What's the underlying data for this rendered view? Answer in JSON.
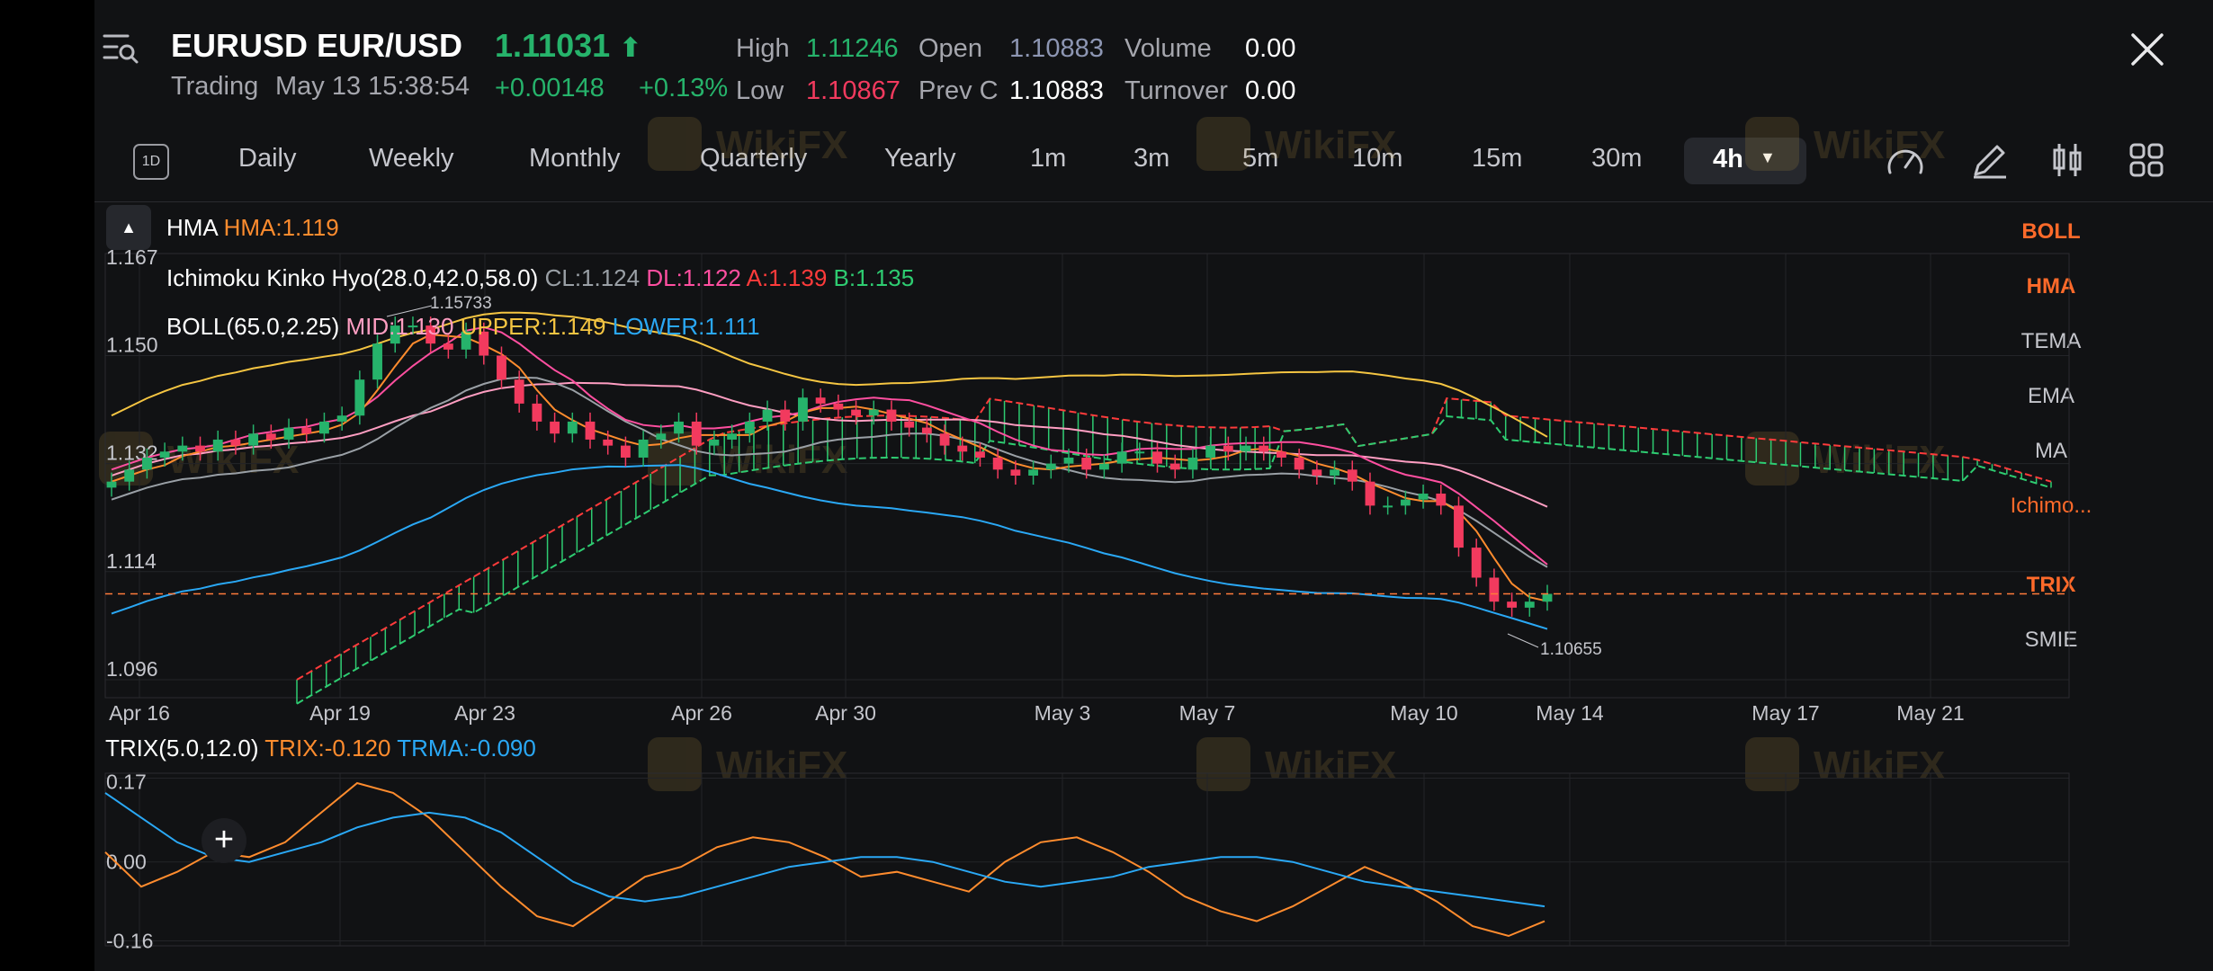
{
  "header": {
    "symbol": "EURUSD",
    "name": "EUR/USD",
    "price": "1.11031",
    "status": "Trading",
    "datetime": "May 13 15:38:54",
    "change": "+0.00148",
    "change_pct": "+0.13%",
    "high_label": "High",
    "high": "1.11246",
    "open_label": "Open",
    "open": "1.10883",
    "volume_label": "Volume",
    "volume": "0.00",
    "low_label": "Low",
    "low": "1.10867",
    "prevc_label": "Prev C",
    "prevc": "1.10883",
    "turnover_label": "Turnover",
    "turnover": "0.00"
  },
  "timeframes": {
    "period_icon_text": "1D",
    "daily": "Daily",
    "weekly": "Weekly",
    "monthly": "Monthly",
    "quarterly": "Quarterly",
    "yearly": "Yearly",
    "m1": "1m",
    "m3": "3m",
    "m5": "5m",
    "m10": "10m",
    "m15": "15m",
    "m30": "30m",
    "active": "4h"
  },
  "indicators_side": [
    "BOLL",
    "HMA",
    "TEMA",
    "EMA",
    "MA",
    "Ichimo...",
    "TRIX",
    "SMIE"
  ],
  "legends": {
    "hma_name": "HMA",
    "hma_val": "HMA:1.119",
    "ichi_name": "Ichimoku Kinko Hyo(28.0,42.0,58.0)",
    "ichi_cl": "CL:1.124",
    "ichi_dl": "DL:1.122",
    "ichi_a": "A:1.139",
    "ichi_b": "B:1.135",
    "boll_name": "BOLL(65.0,2.25)",
    "boll_mid": "MID:1.130",
    "boll_upper": "UPPER:1.149",
    "boll_lower": "LOWER:1.111",
    "trix_name": "TRIX(5.0,12.0)",
    "trix_val": "TRIX:-0.120",
    "trma_val": "TRMA:-0.090"
  },
  "colors": {
    "up": "#26b36b",
    "down": "#f23a5e",
    "hma": "#ff8c2e",
    "cl": "#9aa0a6",
    "dl": "#ff4fa0",
    "span_a": "#ff3b3b",
    "span_b": "#2ecc71",
    "boll_mid": "#ff9ec2",
    "boll_upper": "#f5c542",
    "boll_lower": "#2aa8f5",
    "trix": "#ff8c2e",
    "trma": "#2aa8f5",
    "watermark_text": "WikiFX"
  },
  "chart_data": [
    {
      "type": "candlestick",
      "title": "EURUSD EUR/USD 4h",
      "x_ticks": [
        "Apr 16",
        "Apr 19",
        "Apr 23",
        "Apr 26",
        "Apr 30",
        "May 3",
        "May 7",
        "May 10",
        "May 14",
        "May 17",
        "May 21"
      ],
      "y_ticks": [
        "1.167",
        "1.150",
        "1.132",
        "1.114",
        "1.096"
      ],
      "ylim": [
        1.093,
        1.167
      ],
      "current_price": 1.11031,
      "annotations": [
        {
          "text": "1.15733"
        },
        {
          "text": "1.10655"
        }
      ],
      "series": [
        {
          "name": "Close",
          "values": [
            1.129,
            1.131,
            1.133,
            1.134,
            1.135,
            1.134,
            1.136,
            1.135,
            1.137,
            1.136,
            1.138,
            1.137,
            1.139,
            1.14,
            1.146,
            1.152,
            1.155,
            1.155,
            1.152,
            1.151,
            1.154,
            1.15,
            1.146,
            1.142,
            1.139,
            1.137,
            1.139,
            1.136,
            1.135,
            1.133,
            1.136,
            1.137,
            1.139,
            1.135,
            1.136,
            1.137,
            1.139,
            1.141,
            1.139,
            1.143,
            1.142,
            1.141,
            1.14,
            1.141,
            1.139,
            1.138,
            1.137,
            1.135,
            1.134,
            1.133,
            1.131,
            1.13,
            1.131,
            1.132,
            1.133,
            1.131,
            1.132,
            1.134,
            1.134,
            1.132,
            1.131,
            1.133,
            1.135,
            1.134,
            1.135,
            1.134,
            1.133,
            1.131,
            1.13,
            1.131,
            1.129,
            1.125,
            1.125,
            1.126,
            1.127,
            1.125,
            1.118,
            1.113,
            1.109,
            1.108,
            1.109,
            1.1103
          ]
        }
      ]
    },
    {
      "type": "line",
      "title": "TRIX(5.0,12.0)",
      "y_ticks": [
        "0.17",
        "0.00",
        "-0.16"
      ],
      "ylim": [
        -0.17,
        0.18
      ],
      "series": [
        {
          "name": "TRIX",
          "values": [
            0.02,
            -0.05,
            -0.02,
            0.02,
            0.01,
            0.04,
            0.1,
            0.16,
            0.14,
            0.09,
            0.02,
            -0.05,
            -0.11,
            -0.13,
            -0.08,
            -0.03,
            -0.01,
            0.03,
            0.05,
            0.04,
            0.01,
            -0.03,
            -0.02,
            -0.04,
            -0.06,
            0.0,
            0.04,
            0.05,
            0.02,
            -0.02,
            -0.07,
            -0.1,
            -0.12,
            -0.09,
            -0.05,
            -0.01,
            -0.04,
            -0.08,
            -0.13,
            -0.15,
            -0.12
          ]
        },
        {
          "name": "TRMA",
          "values": [
            0.14,
            0.09,
            0.04,
            0.01,
            0.0,
            0.02,
            0.04,
            0.07,
            0.09,
            0.1,
            0.09,
            0.06,
            0.01,
            -0.04,
            -0.07,
            -0.08,
            -0.07,
            -0.05,
            -0.03,
            -0.01,
            0.0,
            0.01,
            0.01,
            0.0,
            -0.02,
            -0.04,
            -0.05,
            -0.04,
            -0.03,
            -0.01,
            0.0,
            0.01,
            0.01,
            0.0,
            -0.02,
            -0.04,
            -0.05,
            -0.06,
            -0.07,
            -0.08,
            -0.09
          ]
        }
      ]
    }
  ]
}
